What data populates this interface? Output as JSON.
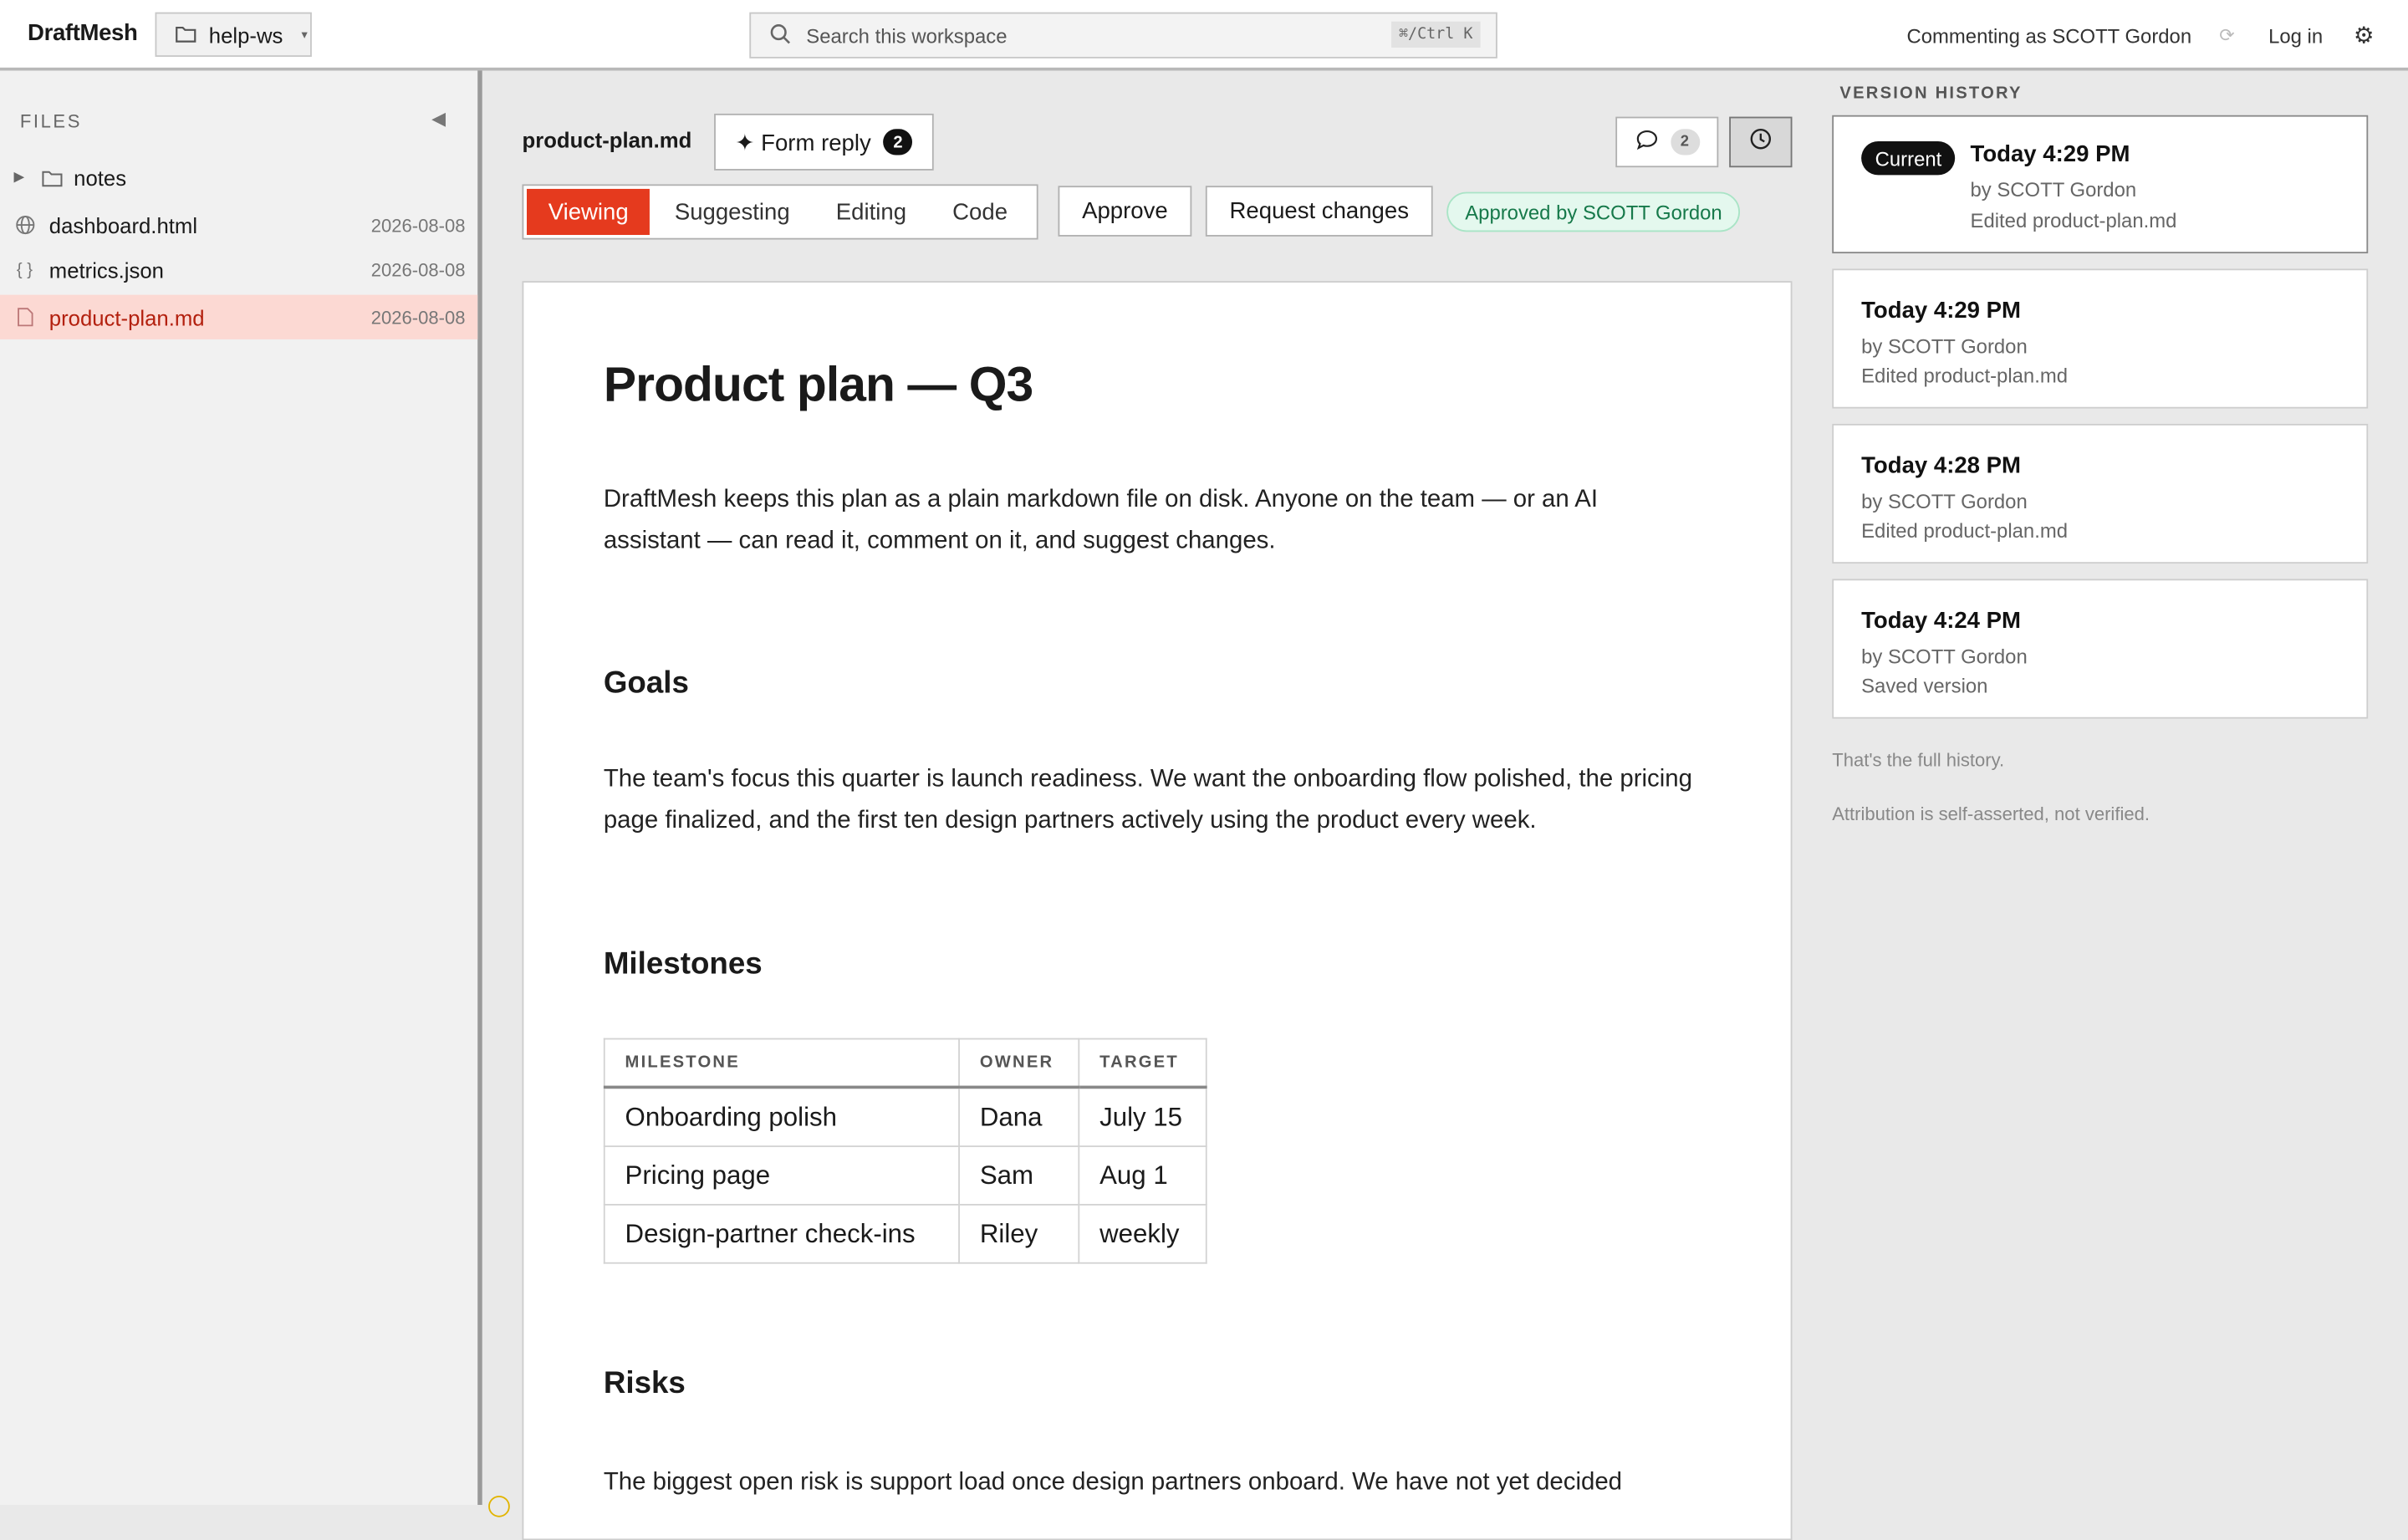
{
  "app": {
    "brand": "DraftMesh",
    "workspace": "help-ws"
  },
  "search": {
    "placeholder": "Search this workspace",
    "shortcut": "⌘/Ctrl K"
  },
  "topbar": {
    "commenting": "Commenting as SCOTT Gordon",
    "login": "Log in"
  },
  "sidebar": {
    "title": "FILES",
    "items": [
      {
        "name": "notes",
        "date": "",
        "type": "folder"
      },
      {
        "name": "dashboard.html",
        "date": "2026-08-08",
        "type": "globe"
      },
      {
        "name": "metrics.json",
        "date": "2026-08-08",
        "type": "json"
      },
      {
        "name": "product-plan.md",
        "date": "2026-08-08",
        "type": "file",
        "active": true
      }
    ]
  },
  "toolbar": {
    "filename": "product-plan.md",
    "form_reply": "✦ Form reply",
    "form_reply_count": "2",
    "comments_count": "2",
    "modes": [
      "Viewing",
      "Suggesting",
      "Editing",
      "Code"
    ],
    "active_mode": "Viewing",
    "approve": "Approve",
    "request_changes": "Request changes",
    "approved_badge": "Approved by SCOTT Gordon"
  },
  "doc": {
    "title": "Product plan — Q3",
    "intro": "DraftMesh keeps this plan as a plain markdown file on disk. Anyone on the team — or an AI assistant — can read it, comment on it, and suggest changes.",
    "goals_heading": "Goals",
    "goals_text": "The team's focus this quarter is launch readiness. We want the onboarding flow polished, the pricing page finalized, and the first ten design partners actively using the product every week.",
    "milestones_heading": "Milestones",
    "table": {
      "headers": [
        "MILESTONE",
        "OWNER",
        "TARGET"
      ],
      "rows": [
        [
          "Onboarding polish",
          "Dana",
          "July 15"
        ],
        [
          "Pricing page",
          "Sam",
          "Aug 1"
        ],
        [
          "Design-partner check-ins",
          "Riley",
          "weekly"
        ]
      ]
    },
    "risks_heading": "Risks",
    "risks_text": "The biggest open risk is support load once design partners onboard. We have not yet decided"
  },
  "version_history": {
    "title": "VERSION HISTORY",
    "current_label": "Current",
    "versions": [
      {
        "time": "Today 4:29 PM",
        "by": "by SCOTT Gordon",
        "action": "Edited product-plan.md"
      },
      {
        "time": "Today 4:29 PM",
        "by": "by SCOTT Gordon",
        "action": "Edited product-plan.md"
      },
      {
        "time": "Today 4:28 PM",
        "by": "by SCOTT Gordon",
        "action": "Edited product-plan.md"
      },
      {
        "time": "Today 4:24 PM",
        "by": "by SCOTT Gordon",
        "action": "Saved version"
      }
    ],
    "full_history_note": "That's the full history.",
    "attribution_note": "Attribution is self-asserted, not verified."
  },
  "colors": {
    "accent": "#e53a1e",
    "active_row_bg": "#fcd9d3",
    "approved_green": "#16794a"
  },
  "icons": [
    "folder-icon",
    "search-icon",
    "refresh-icon",
    "gear-icon",
    "collapse-icon",
    "globe-icon",
    "json-icon",
    "file-icon",
    "comment-icon",
    "clock-icon"
  ]
}
